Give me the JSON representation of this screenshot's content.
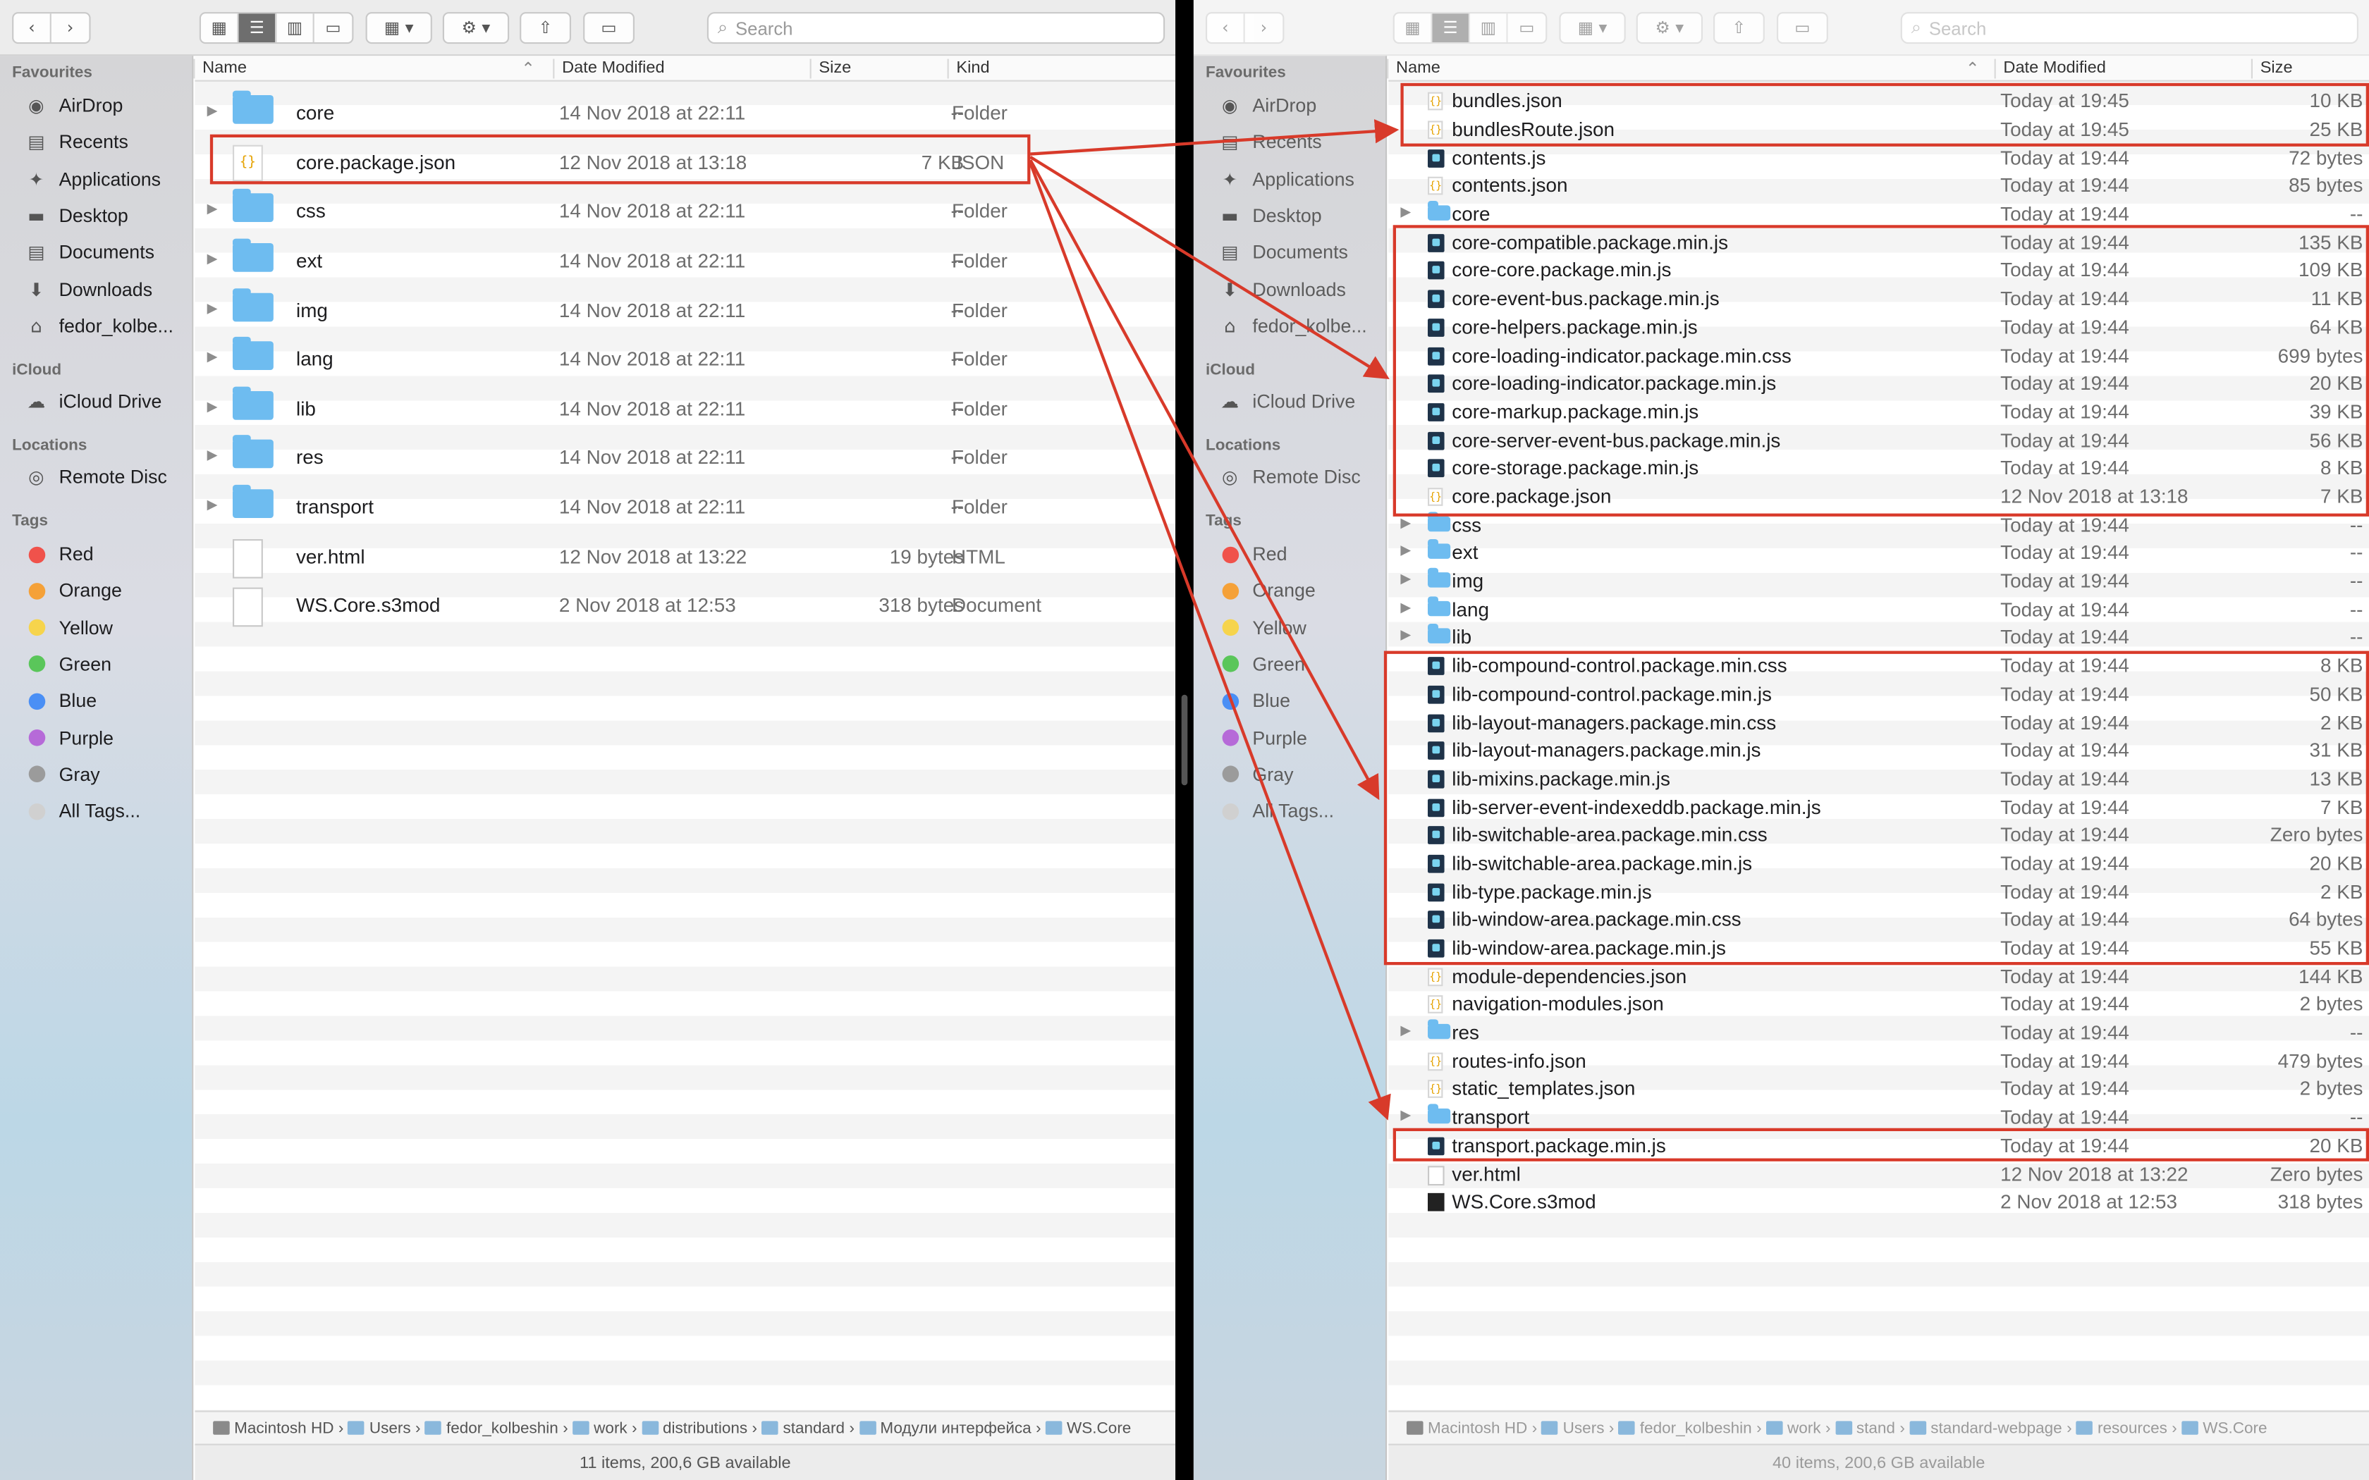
{
  "left_window": {
    "search_placeholder": "Search",
    "columns": {
      "name": "Name",
      "date": "Date Modified",
      "size": "Size",
      "kind": "Kind"
    },
    "rows": [
      {
        "name": "core",
        "date": "14 Nov 2018 at 22:11",
        "size": "--",
        "kind": "Folder",
        "type": "folder"
      },
      {
        "name": "core.package.json",
        "date": "12 Nov 2018 at 13:18",
        "size": "7 KB",
        "kind": "JSON",
        "type": "json"
      },
      {
        "name": "css",
        "date": "14 Nov 2018 at 22:11",
        "size": "--",
        "kind": "Folder",
        "type": "folder"
      },
      {
        "name": "ext",
        "date": "14 Nov 2018 at 22:11",
        "size": "--",
        "kind": "Folder",
        "type": "folder"
      },
      {
        "name": "img",
        "date": "14 Nov 2018 at 22:11",
        "size": "--",
        "kind": "Folder",
        "type": "folder"
      },
      {
        "name": "lang",
        "date": "14 Nov 2018 at 22:11",
        "size": "--",
        "kind": "Folder",
        "type": "folder"
      },
      {
        "name": "lib",
        "date": "14 Nov 2018 at 22:11",
        "size": "--",
        "kind": "Folder",
        "type": "folder"
      },
      {
        "name": "res",
        "date": "14 Nov 2018 at 22:11",
        "size": "--",
        "kind": "Folder",
        "type": "folder"
      },
      {
        "name": "transport",
        "date": "14 Nov 2018 at 22:11",
        "size": "--",
        "kind": "Folder",
        "type": "folder"
      },
      {
        "name": "ver.html",
        "date": "12 Nov 2018 at 13:22",
        "size": "19 bytes",
        "kind": "HTML",
        "type": "html"
      },
      {
        "name": "WS.Core.s3mod",
        "date": "2 Nov 2018 at 12:53",
        "size": "318 bytes",
        "kind": "Document",
        "type": "doc"
      }
    ],
    "path": [
      "Macintosh HD",
      "Users",
      "fedor_kolbeshin",
      "work",
      "distributions",
      "standard",
      "Модули интерфейса",
      "WS.Core"
    ],
    "status": "11 items, 200,6 GB available"
  },
  "right_window": {
    "search_placeholder": "Search",
    "columns": {
      "name": "Name",
      "date": "Date Modified",
      "size": "Size"
    },
    "rows": [
      {
        "name": "bundles.json",
        "date": "Today at 19:45",
        "size": "10 KB",
        "type": "json"
      },
      {
        "name": "bundlesRoute.json",
        "date": "Today at 19:45",
        "size": "25 KB",
        "type": "json"
      },
      {
        "name": "contents.js",
        "date": "Today at 19:44",
        "size": "72 bytes",
        "type": "js"
      },
      {
        "name": "contents.json",
        "date": "Today at 19:44",
        "size": "85 bytes",
        "type": "json"
      },
      {
        "name": "core",
        "date": "Today at 19:44",
        "size": "--",
        "type": "folder"
      },
      {
        "name": "core-compatible.package.min.js",
        "date": "Today at 19:44",
        "size": "135 KB",
        "type": "js"
      },
      {
        "name": "core-core.package.min.js",
        "date": "Today at 19:44",
        "size": "109 KB",
        "type": "js"
      },
      {
        "name": "core-event-bus.package.min.js",
        "date": "Today at 19:44",
        "size": "11 KB",
        "type": "js"
      },
      {
        "name": "core-helpers.package.min.js",
        "date": "Today at 19:44",
        "size": "64 KB",
        "type": "js"
      },
      {
        "name": "core-loading-indicator.package.min.css",
        "date": "Today at 19:44",
        "size": "699 bytes",
        "type": "js"
      },
      {
        "name": "core-loading-indicator.package.min.js",
        "date": "Today at 19:44",
        "size": "20 KB",
        "type": "js"
      },
      {
        "name": "core-markup.package.min.js",
        "date": "Today at 19:44",
        "size": "39 KB",
        "type": "js"
      },
      {
        "name": "core-server-event-bus.package.min.js",
        "date": "Today at 19:44",
        "size": "56 KB",
        "type": "js"
      },
      {
        "name": "core-storage.package.min.js",
        "date": "Today at 19:44",
        "size": "8 KB",
        "type": "js"
      },
      {
        "name": "core.package.json",
        "date": "12 Nov 2018 at 13:18",
        "size": "7 KB",
        "type": "json"
      },
      {
        "name": "css",
        "date": "Today at 19:44",
        "size": "--",
        "type": "folder"
      },
      {
        "name": "ext",
        "date": "Today at 19:44",
        "size": "--",
        "type": "folder"
      },
      {
        "name": "img",
        "date": "Today at 19:44",
        "size": "--",
        "type": "folder"
      },
      {
        "name": "lang",
        "date": "Today at 19:44",
        "size": "--",
        "type": "folder"
      },
      {
        "name": "lib",
        "date": "Today at 19:44",
        "size": "--",
        "type": "folder"
      },
      {
        "name": "lib-compound-control.package.min.css",
        "date": "Today at 19:44",
        "size": "8 KB",
        "type": "js"
      },
      {
        "name": "lib-compound-control.package.min.js",
        "date": "Today at 19:44",
        "size": "50 KB",
        "type": "js"
      },
      {
        "name": "lib-layout-managers.package.min.css",
        "date": "Today at 19:44",
        "size": "2 KB",
        "type": "js"
      },
      {
        "name": "lib-layout-managers.package.min.js",
        "date": "Today at 19:44",
        "size": "31 KB",
        "type": "js"
      },
      {
        "name": "lib-mixins.package.min.js",
        "date": "Today at 19:44",
        "size": "13 KB",
        "type": "js"
      },
      {
        "name": "lib-server-event-indexeddb.package.min.js",
        "date": "Today at 19:44",
        "size": "7 KB",
        "type": "js"
      },
      {
        "name": "lib-switchable-area.package.min.css",
        "date": "Today at 19:44",
        "size": "Zero bytes",
        "type": "js"
      },
      {
        "name": "lib-switchable-area.package.min.js",
        "date": "Today at 19:44",
        "size": "20 KB",
        "type": "js"
      },
      {
        "name": "lib-type.package.min.js",
        "date": "Today at 19:44",
        "size": "2 KB",
        "type": "js"
      },
      {
        "name": "lib-window-area.package.min.css",
        "date": "Today at 19:44",
        "size": "64 bytes",
        "type": "js"
      },
      {
        "name": "lib-window-area.package.min.js",
        "date": "Today at 19:44",
        "size": "55 KB",
        "type": "js"
      },
      {
        "name": "module-dependencies.json",
        "date": "Today at 19:44",
        "size": "144 KB",
        "type": "json"
      },
      {
        "name": "navigation-modules.json",
        "date": "Today at 19:44",
        "size": "2 bytes",
        "type": "json"
      },
      {
        "name": "res",
        "date": "Today at 19:44",
        "size": "--",
        "type": "folder"
      },
      {
        "name": "routes-info.json",
        "date": "Today at 19:44",
        "size": "479 bytes",
        "type": "json"
      },
      {
        "name": "static_templates.json",
        "date": "Today at 19:44",
        "size": "2 bytes",
        "type": "json"
      },
      {
        "name": "transport",
        "date": "Today at 19:44",
        "size": "--",
        "type": "folder"
      },
      {
        "name": "transport.package.min.js",
        "date": "Today at 19:44",
        "size": "20 KB",
        "type": "js"
      },
      {
        "name": "ver.html",
        "date": "12 Nov 2018 at 13:22",
        "size": "Zero bytes",
        "type": "html"
      },
      {
        "name": "WS.Core.s3mod",
        "date": "2 Nov 2018 at 12:53",
        "size": "318 bytes",
        "type": "doc"
      }
    ],
    "path": [
      "Macintosh HD",
      "Users",
      "fedor_kolbeshin",
      "work",
      "stand",
      "standard-webpage",
      "resources",
      "WS.Core"
    ],
    "status": "40 items, 200,6 GB available"
  },
  "sidebar": {
    "favourites_title": "Favourites",
    "favourites": [
      {
        "label": "AirDrop",
        "icon": "airdrop-icon"
      },
      {
        "label": "Recents",
        "icon": "recents-icon"
      },
      {
        "label": "Applications",
        "icon": "applications-icon"
      },
      {
        "label": "Desktop",
        "icon": "desktop-icon"
      },
      {
        "label": "Documents",
        "icon": "documents-icon"
      },
      {
        "label": "Downloads",
        "icon": "downloads-icon"
      },
      {
        "label": "fedor_kolbe...",
        "icon": "home-icon"
      }
    ],
    "icloud_title": "iCloud",
    "icloud": [
      {
        "label": "iCloud Drive",
        "icon": "cloud-icon"
      }
    ],
    "locations_title": "Locations",
    "locations": [
      {
        "label": "Remote Disc",
        "icon": "disc-icon"
      }
    ],
    "tags_title": "Tags",
    "tags": [
      {
        "label": "Red",
        "color": "#f0524b"
      },
      {
        "label": "Orange",
        "color": "#f5a138"
      },
      {
        "label": "Yellow",
        "color": "#f6d44c"
      },
      {
        "label": "Green",
        "color": "#5ac65a"
      },
      {
        "label": "Blue",
        "color": "#4a8ff5"
      },
      {
        "label": "Purple",
        "color": "#b66ad8"
      },
      {
        "label": "Gray",
        "color": "#9b9b9b"
      },
      {
        "label": "All Tags...",
        "color": "#d0d0d0"
      }
    ]
  },
  "colors": {
    "highlight": "#d83a2a",
    "folder": "#6ebcf0"
  }
}
